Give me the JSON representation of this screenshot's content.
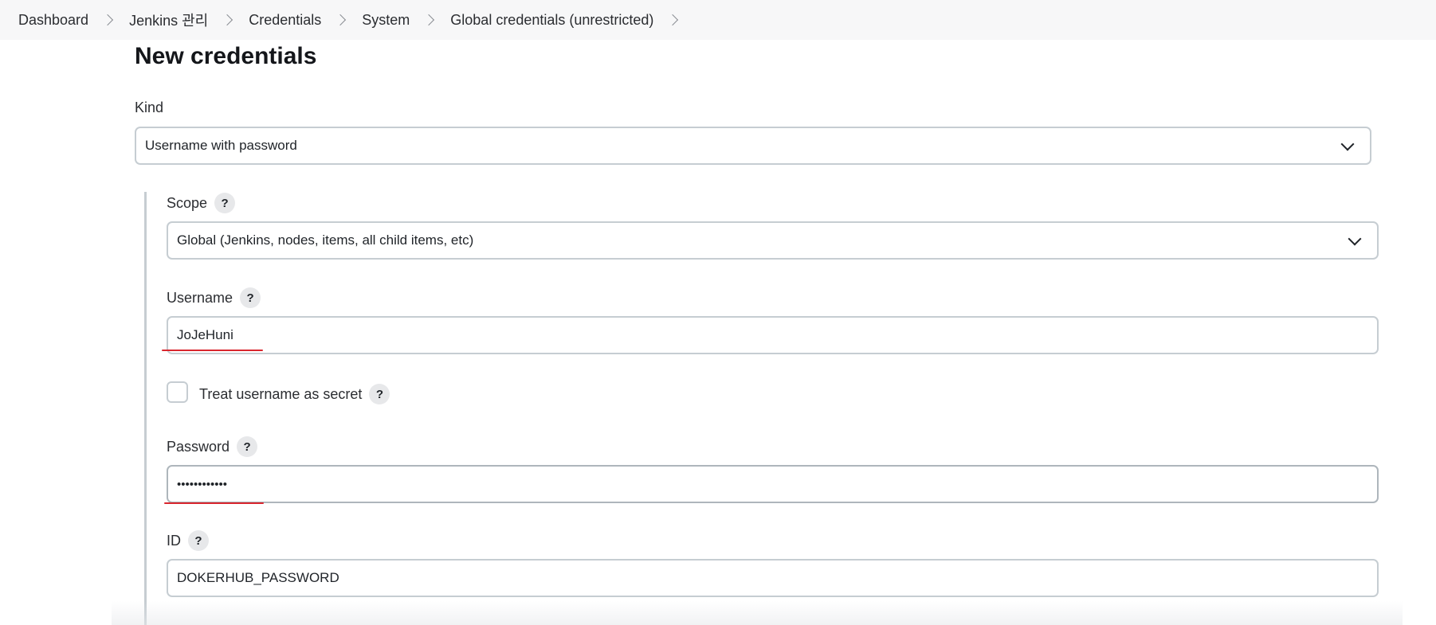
{
  "breadcrumb": {
    "items": [
      "Dashboard",
      "Jenkins 관리",
      "Credentials",
      "System",
      "Global credentials (unrestricted)"
    ]
  },
  "page": {
    "title": "New credentials"
  },
  "form": {
    "kind": {
      "label": "Kind",
      "value": "Username with password"
    },
    "scope": {
      "label": "Scope",
      "value": "Global (Jenkins, nodes, items, all child items, etc)",
      "help": "?"
    },
    "username": {
      "label": "Username",
      "value": "JoJeHuni",
      "help": "?"
    },
    "treat_secret": {
      "label": "Treat username as secret",
      "checked": false,
      "help": "?"
    },
    "password": {
      "label": "Password",
      "value": "••••••••••••",
      "help": "?"
    },
    "id": {
      "label": "ID",
      "value": "DOKERHUB_PASSWORD",
      "help": "?"
    }
  },
  "colors": {
    "annotation_underline": "#d9262e",
    "input_border": "#c6cdd2",
    "breadcrumb_bg": "#f7f7f8"
  },
  "icons": {
    "breadcrumb_separator": "chevron-right-icon",
    "select_arrow": "chevron-down-icon",
    "help": "help-icon"
  }
}
